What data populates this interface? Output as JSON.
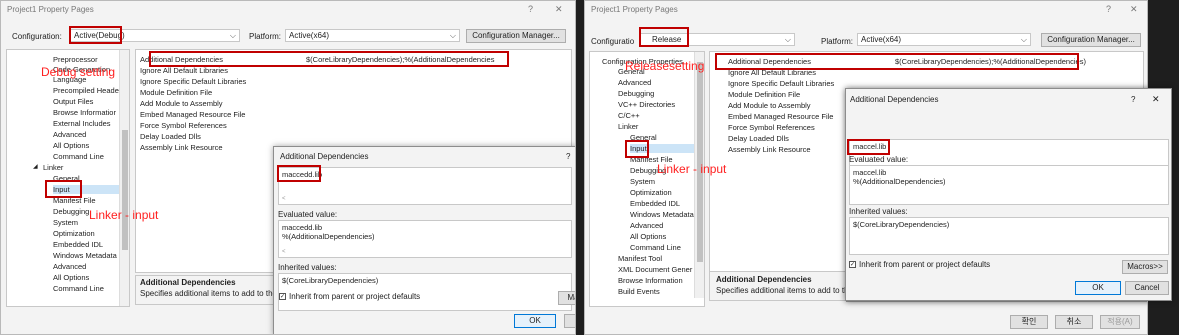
{
  "left": {
    "title": "Project1 Property Pages",
    "help": "?",
    "close": "✕",
    "config_label": "Configuration:",
    "config_value": "Active(Debug)",
    "platform_label": "Platform:",
    "platform_value": "Active(x64)",
    "config_manager": "Configuration Manager...",
    "tree": [
      "Preprocessor",
      "Code Generation",
      "Language",
      "Precompiled Heade",
      "Output Files",
      "Browse Informatior",
      "External Includes",
      "Advanced",
      "All Options",
      "Command Line",
      "Linker",
      "General",
      "Input",
      "Manifest File",
      "Debugging",
      "System",
      "Optimization",
      "Embedded IDL",
      "Windows Metadata",
      "Advanced",
      "All Options",
      "Command Line"
    ],
    "tree_linker_arrow": "◢",
    "grid_rows": [
      [
        "Additional Dependencies",
        "$(CoreLibraryDependencies);%(AdditionalDependencies"
      ],
      [
        "Ignore All Default Libraries",
        ""
      ],
      [
        "Ignore Specific Default Libraries",
        ""
      ],
      [
        "Module Definition File",
        ""
      ],
      [
        "Add Module to Assembly",
        ""
      ],
      [
        "Embed Managed Resource File",
        ""
      ],
      [
        "Force Symbol References",
        ""
      ],
      [
        "Delay Loaded Dlls",
        ""
      ],
      [
        "Assembly Link Resource",
        ""
      ]
    ],
    "desc_title": "Additional Dependencies",
    "desc_text": "Specifies additional items to add to the",
    "ann_debug": "Debug setting",
    "ann_linker": "Linker - input",
    "dlg": {
      "title": "Additional Dependencies",
      "help": "?",
      "input": "maccedd.lib",
      "eval_label": "Evaluated value:",
      "eval_text": "maccedd.lib\n%(AdditionalDependencies)",
      "inh_label": "Inherited values:",
      "inh_text": "$(CoreLibraryDependencies)",
      "inherit": "Inherit from parent or project defaults",
      "macros": "Ma",
      "ok": "OK",
      "cancel": "C"
    }
  },
  "right": {
    "title": "Project1 Property Pages",
    "help": "?",
    "close": "✕",
    "config_label": "Configuratio",
    "config_value": "Release",
    "platform_label": "Platform:",
    "platform_value": "Active(x64)",
    "config_manager": "Configuration Manager...",
    "tree": [
      "Configuration Properties",
      "General",
      "Advanced",
      "Debugging",
      "VC++ Directories",
      "C/C++",
      "Linker",
      "General",
      "Input",
      "Manifest File",
      "Debugging",
      "System",
      "Optimization",
      "Embedded IDL",
      "Windows Metadata",
      "Advanced",
      "All Options",
      "Command Line",
      "Manifest Tool",
      "XML Document Gener",
      "Browse Information",
      "Build Events"
    ],
    "grid_rows": [
      [
        "Additional Dependencies",
        "$(CoreLibraryDependencies);%(AdditionalDependencies)"
      ],
      [
        "Ignore All Default Libraries",
        ""
      ],
      [
        "Ignore Specific Default Libraries",
        ""
      ],
      [
        "Module Definition File",
        ""
      ],
      [
        "Add Module to Assembly",
        ""
      ],
      [
        "Embed Managed Resource File",
        ""
      ],
      [
        "Force Symbol References",
        ""
      ],
      [
        "Delay Loaded Dlls",
        ""
      ],
      [
        "Assembly Link Resource",
        ""
      ]
    ],
    "desc_title": "Additional Dependencies",
    "desc_text": "Specifies additional items to add to th",
    "ann_release": "Releasesetting",
    "ann_linker": "Linker - input",
    "dlg": {
      "title": "Additional Dependencies",
      "help": "?",
      "close": "✕",
      "input": "maccel.lib",
      "eval_label": "Evaluated value:",
      "eval_text": "maccel.lib\n%(AdditionalDependencies)",
      "inh_label": "Inherited values:",
      "inh_text": "$(CoreLibraryDependencies)",
      "inherit": "Inherit from parent or project defaults",
      "macros": "Macros>>",
      "ok": "OK",
      "cancel": "Cancel"
    },
    "footer": {
      "ok": "확인",
      "cancel": "취소",
      "apply": "적용(A)"
    }
  }
}
